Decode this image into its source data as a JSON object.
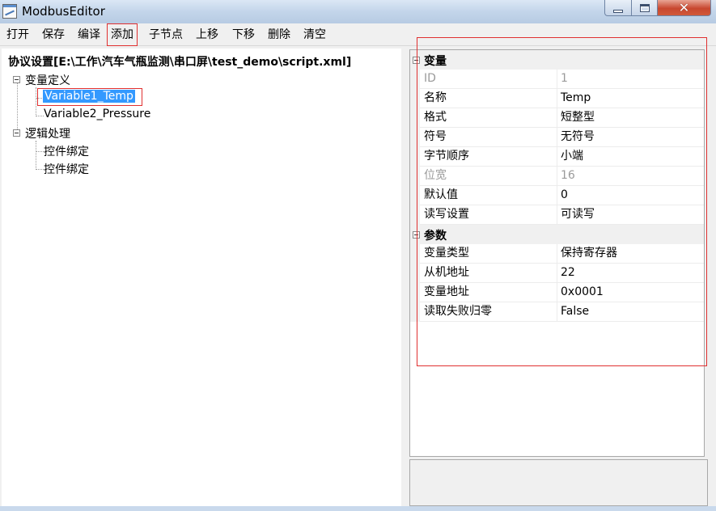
{
  "window": {
    "title": "ModbusEditor",
    "close_glyph": "✕"
  },
  "menu": [
    {
      "label": "打开"
    },
    {
      "label": "保存"
    },
    {
      "label": "编译"
    },
    {
      "label": "添加"
    },
    {
      "label": "子节点"
    },
    {
      "label": "上移"
    },
    {
      "label": "下移"
    },
    {
      "label": "删除"
    },
    {
      "label": "清空"
    }
  ],
  "tree": {
    "root": "协议设置[E:\\工作\\汽车气瓶监测\\串口屏\\test_demo\\script.xml]",
    "groups": [
      {
        "label": "变量定义",
        "children": [
          "Variable1_Temp",
          "Variable2_Pressure"
        ]
      },
      {
        "label": "逻辑处理",
        "children": [
          "控件绑定",
          "控件绑定"
        ]
      }
    ]
  },
  "properties": {
    "categories": [
      {
        "label": "变量",
        "rows": [
          {
            "name": "ID",
            "value": "1"
          },
          {
            "name": "名称",
            "value": "Temp"
          },
          {
            "name": "格式",
            "value": "短整型"
          },
          {
            "name": "符号",
            "value": "无符号"
          },
          {
            "name": "字节顺序",
            "value": "小端"
          },
          {
            "name": "位宽",
            "value": "16"
          },
          {
            "name": "默认值",
            "value": "0"
          },
          {
            "name": "读写设置",
            "value": "可读写"
          }
        ]
      },
      {
        "label": "参数",
        "rows": [
          {
            "name": "变量类型",
            "value": "保持寄存器"
          },
          {
            "name": "从机地址",
            "value": "22"
          },
          {
            "name": "变量地址",
            "value": "0x0001"
          },
          {
            "name": "读取失败归零",
            "value": "False"
          }
        ]
      }
    ]
  }
}
